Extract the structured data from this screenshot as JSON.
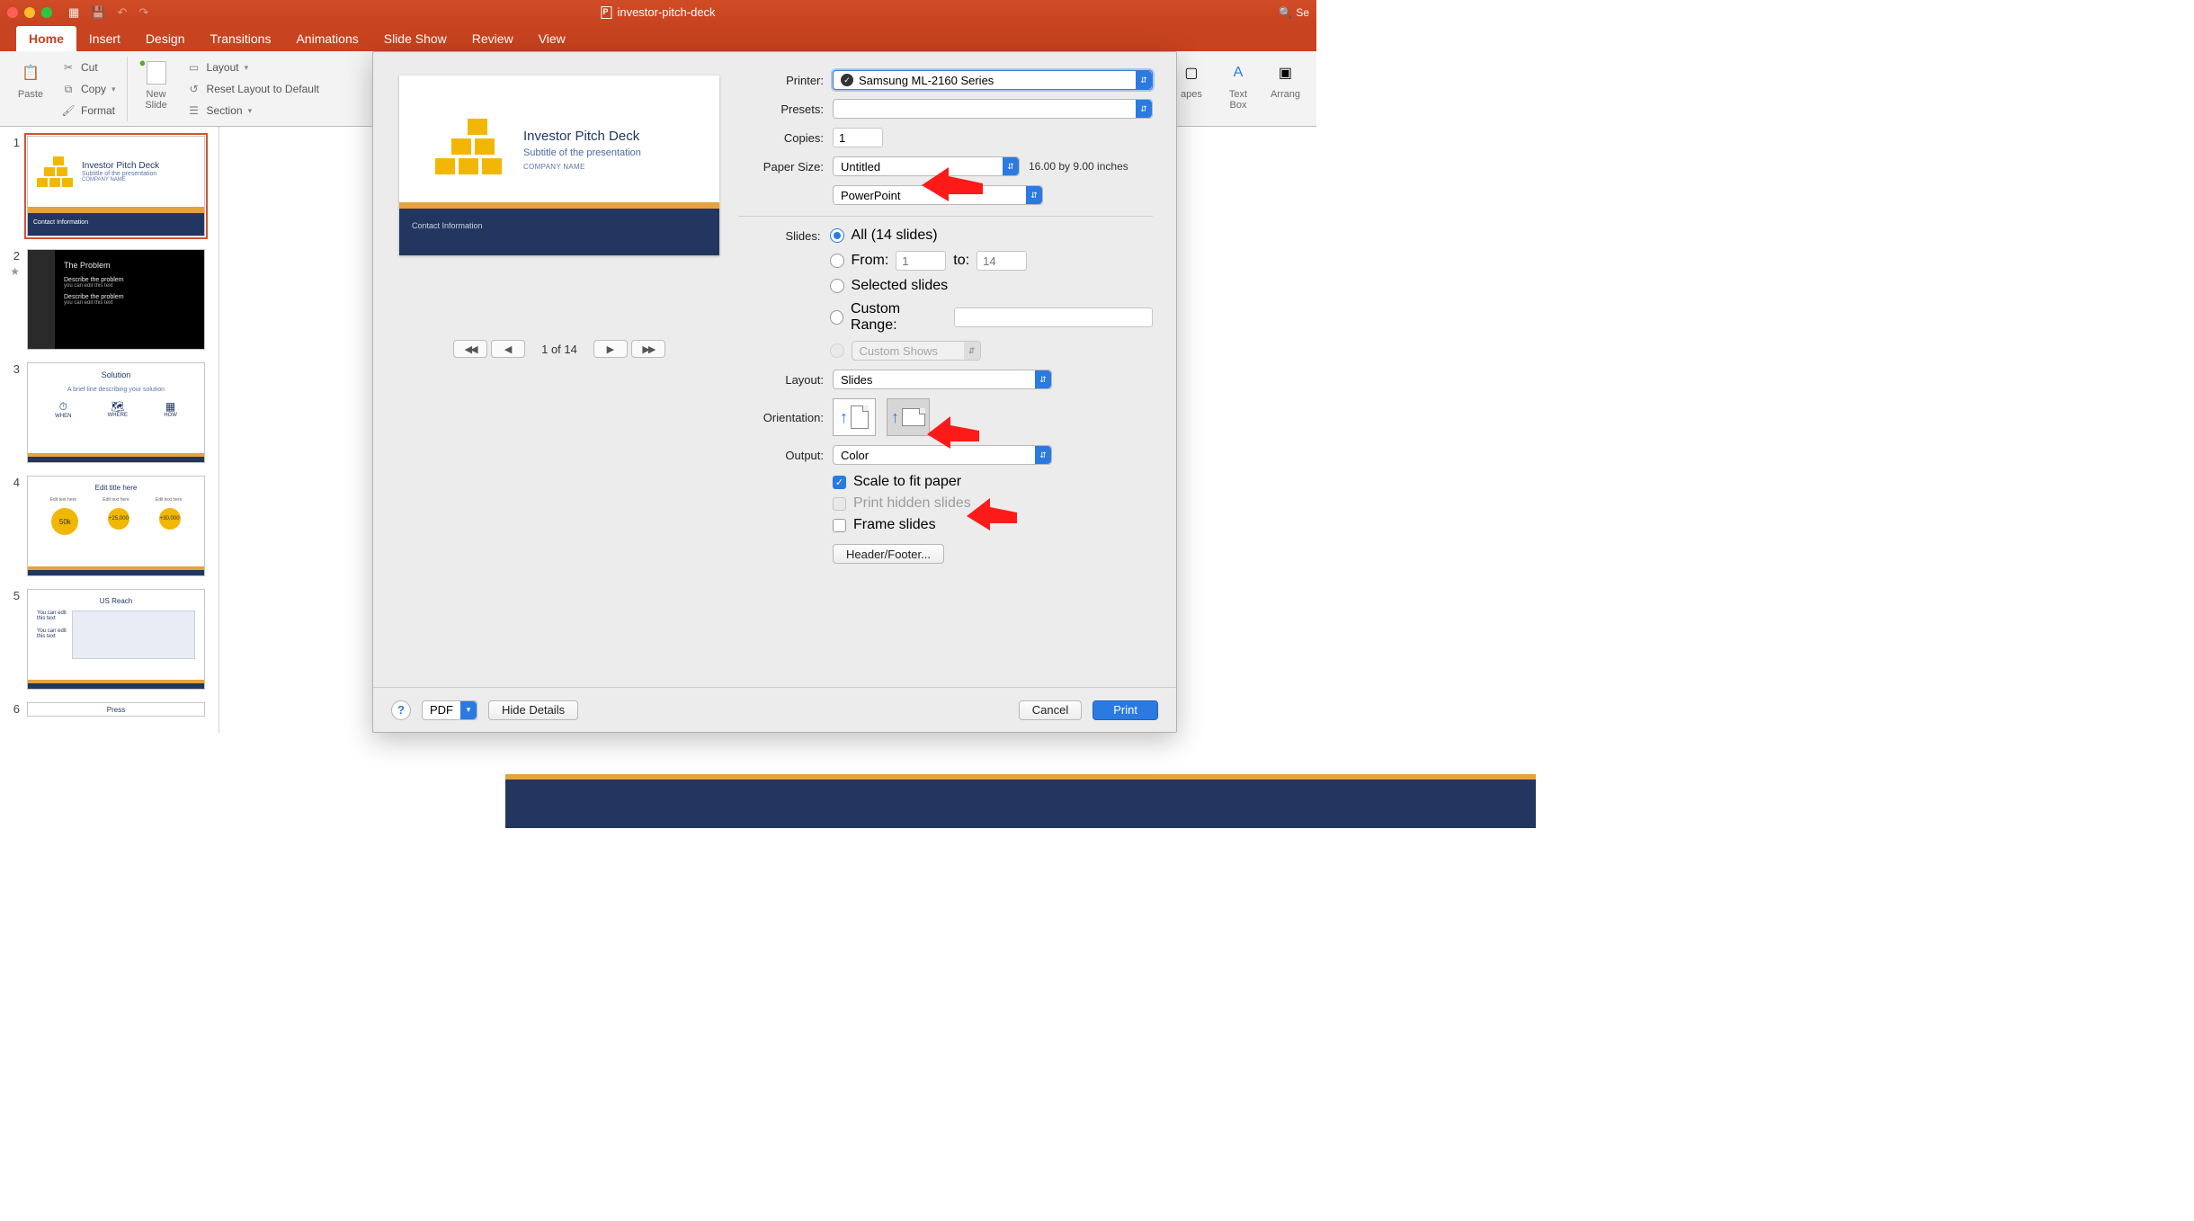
{
  "window": {
    "title": "investor-pitch-deck",
    "search_placeholder": "Se"
  },
  "tabs": {
    "home": "Home",
    "insert": "Insert",
    "design": "Design",
    "transitions": "Transitions",
    "animations": "Animations",
    "slideshow": "Slide Show",
    "review": "Review",
    "view": "View"
  },
  "ribbon": {
    "paste": "Paste",
    "cut": "Cut",
    "copy": "Copy",
    "format": "Format",
    "new_slide": "New\nSlide",
    "layout": "Layout",
    "reset": "Reset Layout to Default",
    "section": "Section",
    "shapes": "apes",
    "textbox": "Text\nBox",
    "arrange": "Arrang"
  },
  "thumbs": {
    "t1": {
      "title": "Investor Pitch Deck",
      "sub": "Subtitle of the presentation",
      "co": "COMPANY NAME",
      "nav": "Contact Information"
    },
    "t2": {
      "title": "The Problem",
      "l1": "Describe the problem",
      "l2": "you can edit this text",
      "l3": "Describe the problem",
      "l4": "you can edit this text"
    },
    "t3": {
      "title": "Solution",
      "sub": "A brief line describing your solution",
      "c1": "WHEN",
      "c2": "WHERE",
      "c3": "HOW"
    },
    "t4": {
      "title": "Edit title here",
      "s1": "Edit text here",
      "s2": "Edit text here",
      "s3": "Edit text here",
      "v1": "50k",
      "v2": "+25,000",
      "v3": "+30,000"
    },
    "t5": {
      "title": "US Reach",
      "l1": "You can edit",
      "l2": "this text",
      "l3": "You can edit",
      "l4": "this text"
    },
    "t6": {
      "title": "Press"
    }
  },
  "preview": {
    "title": "Investor Pitch Deck",
    "sub": "Subtitle of the presentation",
    "company": "COMPANY NAME",
    "nav": "Contact Information",
    "page_label": "1 of 14"
  },
  "print": {
    "labels": {
      "printer": "Printer:",
      "presets": "Presets:",
      "copies": "Copies:",
      "paper_size": "Paper Size:",
      "slides": "Slides:",
      "from": "From:",
      "to": "to:",
      "layout": "Layout:",
      "orientation": "Orientation:",
      "output": "Output:"
    },
    "printer_value": "Samsung ML-2160 Series",
    "presets_value": " ",
    "copies_value": "1",
    "paper_size_value": "Untitled",
    "paper_size_note": "16.00 by 9.00 inches",
    "app_menu_value": "PowerPoint",
    "slides_all": "All  (14 slides)",
    "from_value": "1",
    "to_value": "14",
    "selected": "Selected slides",
    "custom_range": "Custom Range:",
    "custom_shows": "Custom Shows",
    "layout_value": "Slides",
    "output_value": "Color",
    "scale_to_fit": "Scale to fit paper",
    "print_hidden": "Print hidden slides",
    "frame": "Frame slides",
    "header_footer": "Header/Footer...",
    "pdf": "PDF",
    "hide_details": "Hide Details",
    "cancel": "Cancel",
    "print_btn": "Print"
  }
}
